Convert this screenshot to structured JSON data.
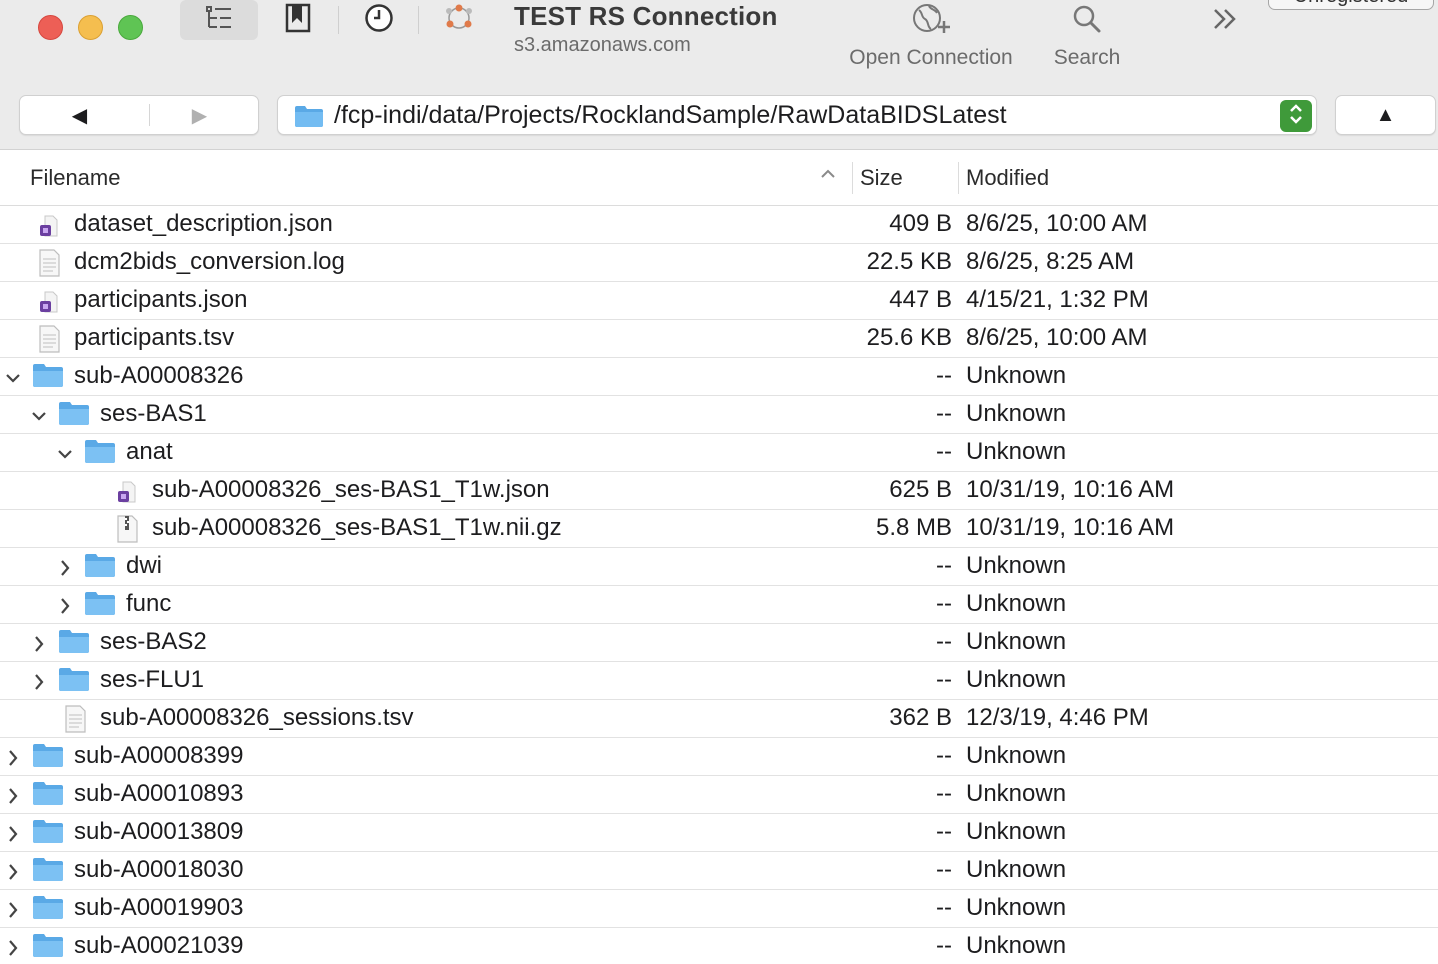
{
  "window": {
    "title": "TEST RS Connection",
    "host": "s3.amazonaws.com",
    "registration_label": "Unregistered"
  },
  "toolbar": {
    "open_connection_label": "Open Connection",
    "search_label": "Search"
  },
  "navigation": {
    "back_glyph": "◀",
    "forward_glyph": "▶",
    "path": "/fcp-indi/data/Projects/RocklandSample/RawDataBIDSLatest",
    "up_glyph": "▲"
  },
  "columns": {
    "filename": "Filename",
    "size": "Size",
    "modified": "Modified"
  },
  "rows": [
    {
      "name": "dataset_description.json",
      "size": "409 B",
      "modified": "8/6/25, 10:00 AM",
      "depth": 0,
      "type": "json",
      "disclosure": "none"
    },
    {
      "name": "dcm2bids_conversion.log",
      "size": "22.5 KB",
      "modified": "8/6/25, 8:25 AM",
      "depth": 0,
      "type": "text",
      "disclosure": "none"
    },
    {
      "name": "participants.json",
      "size": "447 B",
      "modified": "4/15/21, 1:32 PM",
      "depth": 0,
      "type": "json",
      "disclosure": "none"
    },
    {
      "name": "participants.tsv",
      "size": "25.6 KB",
      "modified": "8/6/25, 10:00 AM",
      "depth": 0,
      "type": "text",
      "disclosure": "none"
    },
    {
      "name": "sub-A00008326",
      "size": "--",
      "modified": "Unknown",
      "depth": 0,
      "type": "folder",
      "disclosure": "open"
    },
    {
      "name": "ses-BAS1",
      "size": "--",
      "modified": "Unknown",
      "depth": 1,
      "type": "folder",
      "disclosure": "open"
    },
    {
      "name": "anat",
      "size": "--",
      "modified": "Unknown",
      "depth": 2,
      "type": "folder",
      "disclosure": "open"
    },
    {
      "name": "sub-A00008326_ses-BAS1_T1w.json",
      "size": "625 B",
      "modified": "10/31/19, 10:16 AM",
      "depth": 3,
      "type": "json",
      "disclosure": "none"
    },
    {
      "name": "sub-A00008326_ses-BAS1_T1w.nii.gz",
      "size": "5.8 MB",
      "modified": "10/31/19, 10:16 AM",
      "depth": 3,
      "type": "archive",
      "disclosure": "none"
    },
    {
      "name": "dwi",
      "size": "--",
      "modified": "Unknown",
      "depth": 2,
      "type": "folder",
      "disclosure": "closed"
    },
    {
      "name": "func",
      "size": "--",
      "modified": "Unknown",
      "depth": 2,
      "type": "folder",
      "disclosure": "closed"
    },
    {
      "name": "ses-BAS2",
      "size": "--",
      "modified": "Unknown",
      "depth": 1,
      "type": "folder",
      "disclosure": "closed"
    },
    {
      "name": "ses-FLU1",
      "size": "--",
      "modified": "Unknown",
      "depth": 1,
      "type": "folder",
      "disclosure": "closed"
    },
    {
      "name": "sub-A00008326_sessions.tsv",
      "size": "362 B",
      "modified": "12/3/19, 4:46 PM",
      "depth": 1,
      "type": "text",
      "disclosure": "none"
    },
    {
      "name": "sub-A00008399",
      "size": "--",
      "modified": "Unknown",
      "depth": 0,
      "type": "folder",
      "disclosure": "closed"
    },
    {
      "name": "sub-A00010893",
      "size": "--",
      "modified": "Unknown",
      "depth": 0,
      "type": "folder",
      "disclosure": "closed"
    },
    {
      "name": "sub-A00013809",
      "size": "--",
      "modified": "Unknown",
      "depth": 0,
      "type": "folder",
      "disclosure": "closed"
    },
    {
      "name": "sub-A00018030",
      "size": "--",
      "modified": "Unknown",
      "depth": 0,
      "type": "folder",
      "disclosure": "closed"
    },
    {
      "name": "sub-A00019903",
      "size": "--",
      "modified": "Unknown",
      "depth": 0,
      "type": "folder",
      "disclosure": "closed"
    },
    {
      "name": "sub-A00021039",
      "size": "--",
      "modified": "Unknown",
      "depth": 0,
      "type": "folder",
      "disclosure": "closed"
    }
  ],
  "colors": {
    "folder": "#5aa9e6",
    "stepper": "#3f9a3a",
    "toolbar_bg": "#ebebeb"
  }
}
